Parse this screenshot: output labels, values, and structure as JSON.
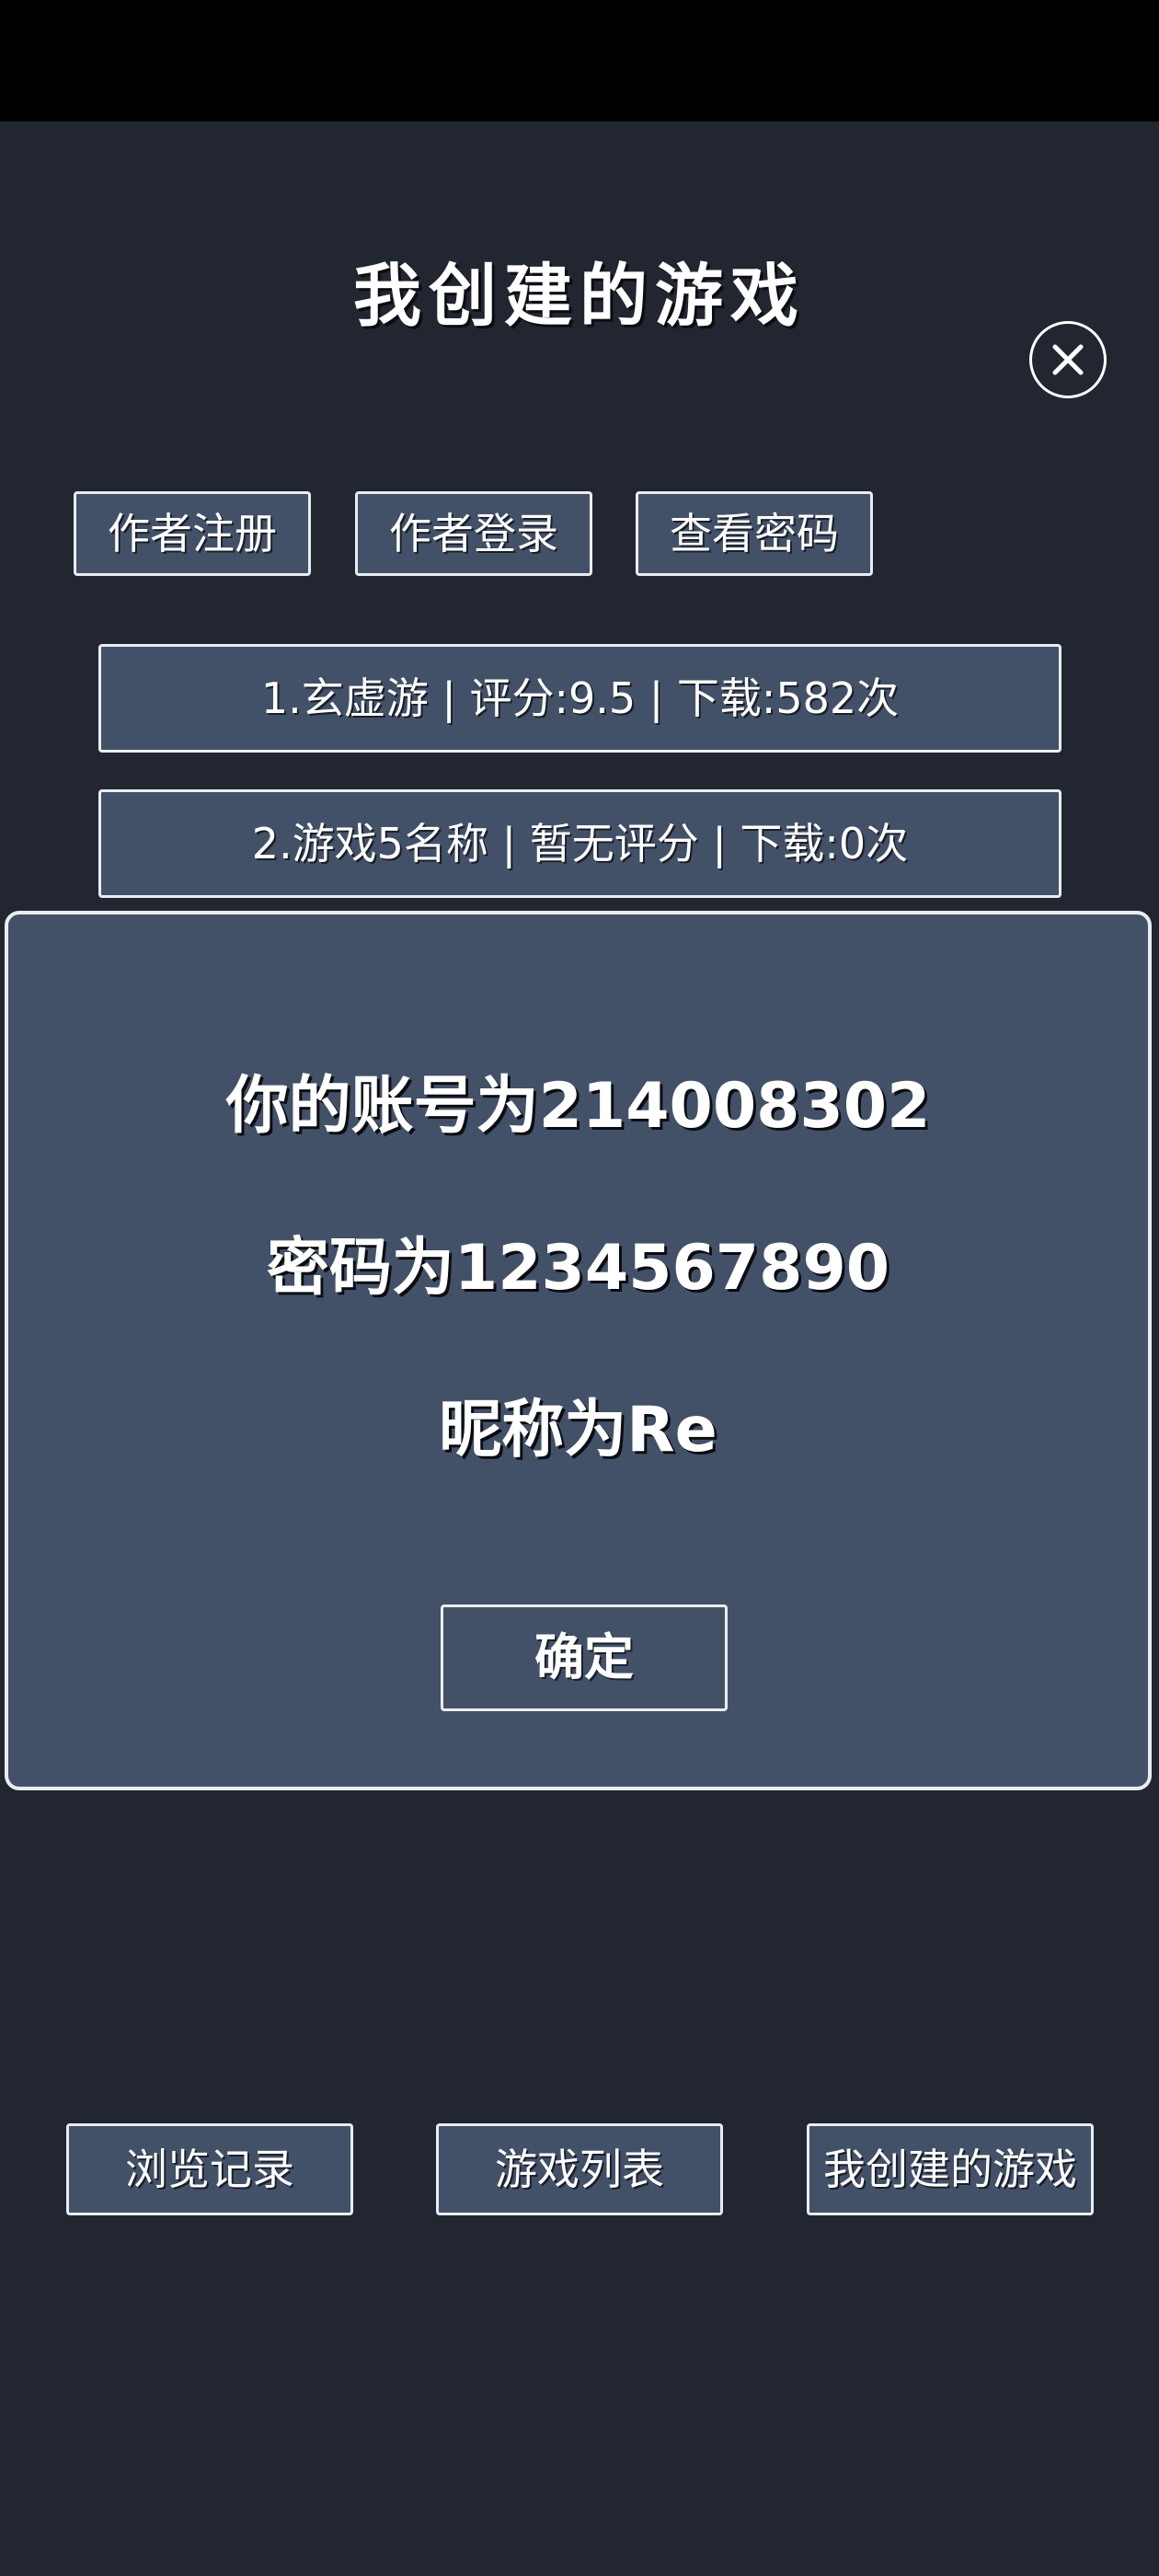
{
  "header": {
    "title": "我创建的游戏",
    "close_icon": "close-icon"
  },
  "author_actions": {
    "register": "作者注册",
    "login": "作者登录",
    "view_password": "查看密码"
  },
  "games": [
    {
      "label": "1.玄虚游 | 评分:9.5 | 下载:582次"
    },
    {
      "label": "2.游戏5名称 | 暂无评分 | 下载:0次"
    }
  ],
  "dialog": {
    "account_line": "你的账号为214008302",
    "password_line": "密码为1234567890",
    "nickname_line": "昵称为Re",
    "confirm_label": "确定"
  },
  "bottom_nav": {
    "history": "浏览记录",
    "game_list": "游戏列表",
    "my_games": "我创建的游戏"
  },
  "colors": {
    "background": "#222630",
    "panel": "#435168",
    "border": "#e9edf2"
  }
}
